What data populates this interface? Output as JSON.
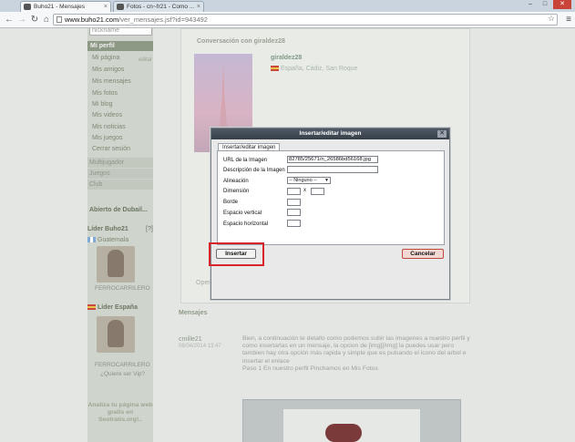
{
  "browser": {
    "tabs": [
      {
        "title": "Buho21 - Mensajes",
        "active": true
      },
      {
        "title": "Fotos - cn~fr21 - Como ...",
        "active": false
      }
    ],
    "window_controls": {
      "minimize": "–",
      "maximize": "□",
      "close": "✕"
    },
    "url_domain": "www.buho21.com",
    "url_path": "/ver_mensajes.jsf?id=943492"
  },
  "sidebar": {
    "search_placeholder": "nickname",
    "profile_header": "Mi perfil",
    "edit_label": "editar",
    "links": [
      "Mi página",
      "Mis amigos",
      "Mis mensajes",
      "Mis fotos",
      "Mi blog",
      "Mis videos",
      "Mis noticias",
      "Mis juegos",
      "Cerrar sesión"
    ],
    "groups": [
      "Multijugador",
      "Juegos",
      "Club"
    ],
    "abierto": "Abierto de Dubail...",
    "leader_buho_title": "Líder Buho21",
    "leader_buho_help": "[?]",
    "leader_buho_country": "Guatemala",
    "leader_buho_name": "FERROCARRILERO",
    "leader_es_title": "Líder España",
    "leader_es_name": "FERROCARRILERO",
    "vip_link": "¿Quiere ser Vip?",
    "promo": "Analiza tu página web gratis en Seotratis.org!.."
  },
  "conversation": {
    "title": "Conversación con giraldez28",
    "user": "giraldez28",
    "location": "España, Cádiz, San Roque",
    "ops": "Oper"
  },
  "messages": {
    "header": "Mensajes",
    "user": "cmille21",
    "date": "08/04/2014 13:47",
    "body": "Bien, a continuación te detallo como podemos subir las imagenes a nuestro perfil y como insertarlas en un mensaje, la opcion de [img][/img] la puedes usar pero tambien hay otra opción más rapida y simple que es pulsando el icono del arbol e insertar el enlace",
    "step": "Paso 1 En nuestro perfil Pinchamos en Mis Fotos"
  },
  "dialog": {
    "title": "Insertar/editar imagen",
    "close_label": "✕",
    "tab": "Insertar/editar imagen",
    "fields": {
      "url_label": "URL de la Imagen",
      "url_value": "82785/25671/n_26586bd56168.jpg",
      "desc_label": "Descripción de la Imagen",
      "align_label": "Alineación",
      "align_value": "-- Ninguno --",
      "dim_label": "Dimensión",
      "dim_sep": "x",
      "border_label": "Borde",
      "vspace_label": "Espacio vertical",
      "hspace_label": "Espacio horizontal"
    },
    "insert_label": "Insertar",
    "cancel_label": "Cancelar"
  }
}
